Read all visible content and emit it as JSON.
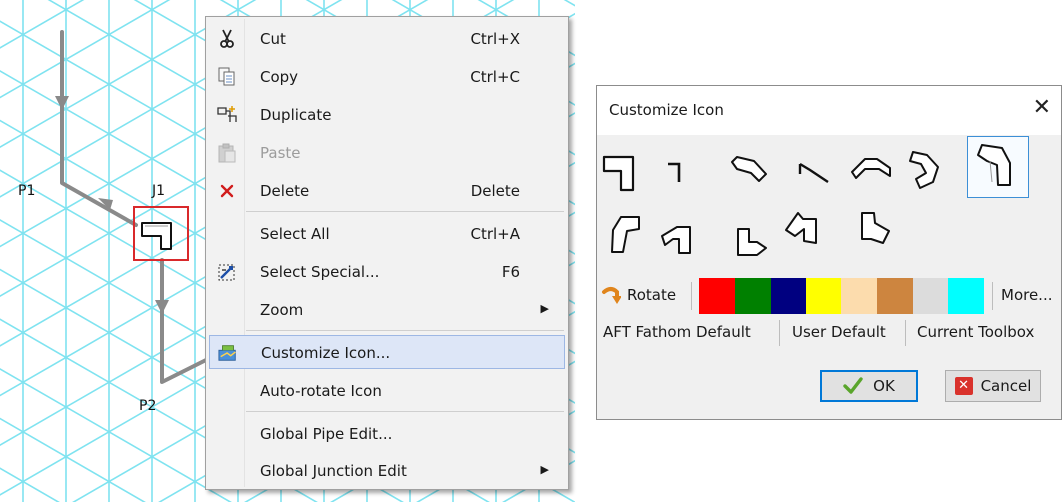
{
  "canvas": {
    "grid_color": "#7fe3f0",
    "pipe_color": "#8a8a8a",
    "selection_color": "#d9292b",
    "labels": {
      "p1": "P1",
      "j1": "J1",
      "p2": "P2"
    }
  },
  "context_menu": {
    "items": [
      {
        "label": "Cut",
        "shortcut": "Ctrl+X",
        "icon": "scissors-icon"
      },
      {
        "label": "Copy",
        "shortcut": "Ctrl+C",
        "icon": "copy-icon"
      },
      {
        "label": "Duplicate",
        "shortcut": "",
        "icon": "duplicate-icon"
      },
      {
        "label": "Paste",
        "shortcut": "",
        "icon": "paste-icon",
        "disabled": true
      },
      {
        "label": "Delete",
        "shortcut": "Delete",
        "icon": "delete-icon"
      },
      {
        "label": "Select All",
        "shortcut": "Ctrl+A"
      },
      {
        "label": "Select Special...",
        "shortcut": "F6",
        "icon": "select-special-icon"
      },
      {
        "label": "Zoom",
        "submenu": true
      },
      {
        "label": "Customize Icon...",
        "icon": "customize-icon",
        "highlighted": true
      },
      {
        "label": "Auto-rotate Icon"
      },
      {
        "label": "Global Pipe Edit..."
      },
      {
        "label": "Global Junction Edit",
        "submenu": true
      }
    ]
  },
  "dialog": {
    "title": "Customize Icon",
    "rotate_label": "Rotate",
    "colors": [
      "#ff0000",
      "#008000",
      "#000080",
      "#ffff00",
      "#fcdcad",
      "#cd853f",
      "#dcdcdc",
      "#00ffff"
    ],
    "more_label": "More...",
    "defaults": {
      "aft_fathom": "AFT Fathom Default",
      "user": "User Default",
      "current_toolbox": "Current Toolbox"
    },
    "ok_label": "OK",
    "cancel_label": "Cancel"
  }
}
